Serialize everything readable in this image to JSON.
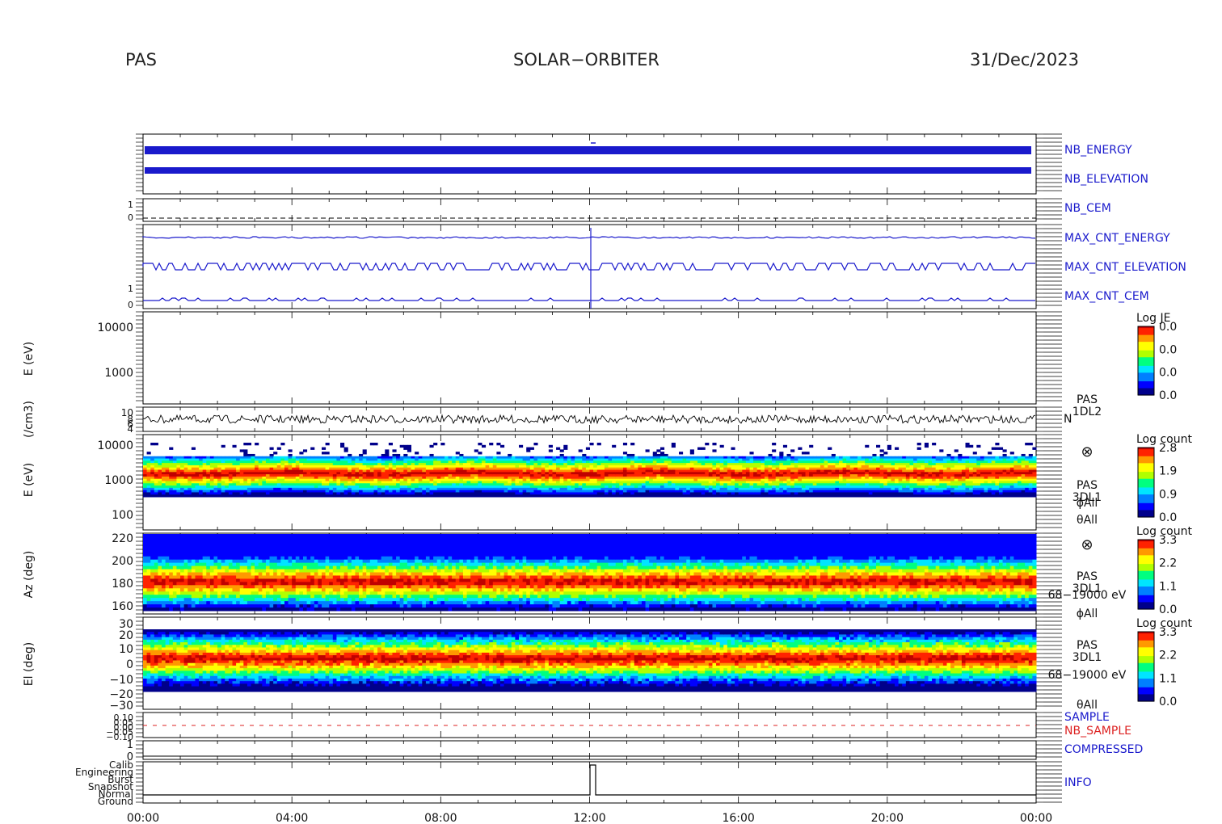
{
  "header": {
    "instrument": "PAS",
    "mission": "SOLAR−ORBITER",
    "date": "31/Dec/2023"
  },
  "colors": {
    "blue": "#1a1acc",
    "red": "#dd2222",
    "black": "#000000"
  },
  "chart_data": {
    "type": "heatmap",
    "x_ticks": [
      "00:00",
      "04:00",
      "08:00",
      "12:00",
      "16:00",
      "20:00",
      "00:00"
    ],
    "x_range_hours": [
      0,
      24
    ],
    "panels": [
      {
        "id": "hk_energy",
        "labels": [
          "NB_ENERGY",
          "NB_ELEVATION"
        ]
      },
      {
        "id": "hk_cem",
        "labels": [
          "NB_CEM"
        ],
        "yticks": [
          "1",
          "0"
        ]
      },
      {
        "id": "hk_maxcnt",
        "labels": [
          "MAX_CNT_ENERGY",
          "MAX_CNT_ELEVATION",
          "MAX_CNT_CEM"
        ],
        "yticks": [
          "1",
          "0"
        ]
      },
      {
        "id": "spec_1dl2",
        "ylabel": "E (eV)",
        "yticks": [
          "10000",
          "1000"
        ],
        "colorbar": {
          "title": "Log JE",
          "ticks": [
            "0.0",
            "0.0",
            "0.0",
            "0.0"
          ]
        }
      },
      {
        "id": "density",
        "ylabel": "(/cm3)",
        "yticks": [
          "10",
          "8",
          "6",
          "4"
        ],
        "label": "N",
        "tag": [
          "PAS",
          "1DL2"
        ]
      },
      {
        "id": "spec_energy",
        "ylabel": "E (eV)",
        "yticks": [
          "10000",
          "1000",
          "100"
        ],
        "tag": [
          "PAS",
          "3DL1",
          "ϕAll",
          "θAll"
        ],
        "colorbar": {
          "title": "Log count",
          "ticks": [
            "2.8",
            "1.9",
            "0.9",
            "0.0"
          ]
        }
      },
      {
        "id": "spec_az",
        "ylabel": "Az (deg)",
        "yticks": [
          "220",
          "200",
          "180",
          "160"
        ],
        "tag": [
          "PAS",
          "3DL1",
          "68−19000 eV",
          "ϕAll"
        ],
        "colorbar": {
          "title": "Log count",
          "ticks": [
            "3.3",
            "2.2",
            "1.1",
            "0.0"
          ]
        }
      },
      {
        "id": "spec_el",
        "ylabel": "El (deg)",
        "yticks": [
          "30",
          "20",
          "10",
          "0",
          "−10",
          "−20",
          "−30"
        ],
        "tag": [
          "PAS",
          "3DL1",
          "68−19000 eV",
          "θAll"
        ],
        "colorbar": {
          "title": "Log count",
          "ticks": [
            "3.3",
            "2.2",
            "1.1",
            "0.0"
          ]
        }
      },
      {
        "id": "sample",
        "labels": [
          "SAMPLE",
          "NB_SAMPLE"
        ],
        "yticks": [
          "0.10",
          "0.05",
          "0.00",
          "−0.05",
          "−0.10"
        ]
      },
      {
        "id": "compressed",
        "labels": [
          "COMPRESSED"
        ],
        "yticks": [
          "1",
          "0"
        ]
      },
      {
        "id": "info",
        "labels": [
          "INFO"
        ],
        "yticks": [
          "Calib",
          "Engineering",
          "Burst",
          "Snapshot",
          "Normal",
          "Ground"
        ]
      }
    ],
    "colorscale": [
      "#00008b",
      "#0000ff",
      "#0080ff",
      "#00e5ff",
      "#00ff80",
      "#b0ff00",
      "#ffff00",
      "#ff9900",
      "#ff2200",
      "#c00000"
    ]
  }
}
